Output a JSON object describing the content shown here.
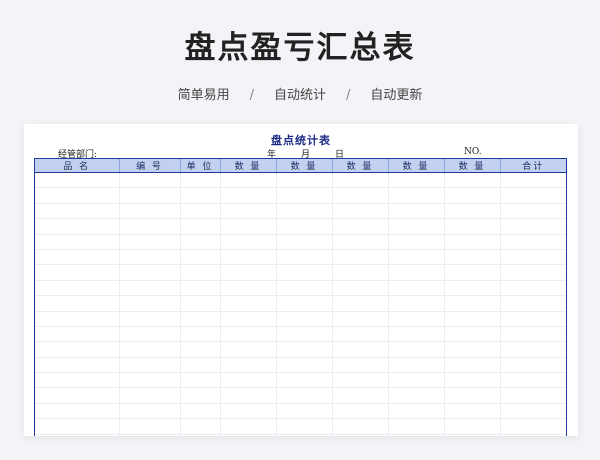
{
  "hero": {
    "title": "盘点盈亏汇总表"
  },
  "tagline": {
    "items": [
      "简单易用",
      "自动统计",
      "自动更新"
    ],
    "separator": "/"
  },
  "sheet": {
    "title": "盘点统计表",
    "department_label": "经管部门:",
    "year_label": "年",
    "month_label": "月",
    "day_label": "日",
    "no_label": "NO.",
    "columns": [
      "品 名",
      "编 号",
      "单 位",
      "数 量",
      "数 量",
      "数 量",
      "数 量",
      "数 量",
      "合计"
    ],
    "row_count": 18,
    "colors": {
      "header_bg": "#c3d1f0",
      "border": "#223a9a",
      "title": "#1b2a86"
    }
  }
}
